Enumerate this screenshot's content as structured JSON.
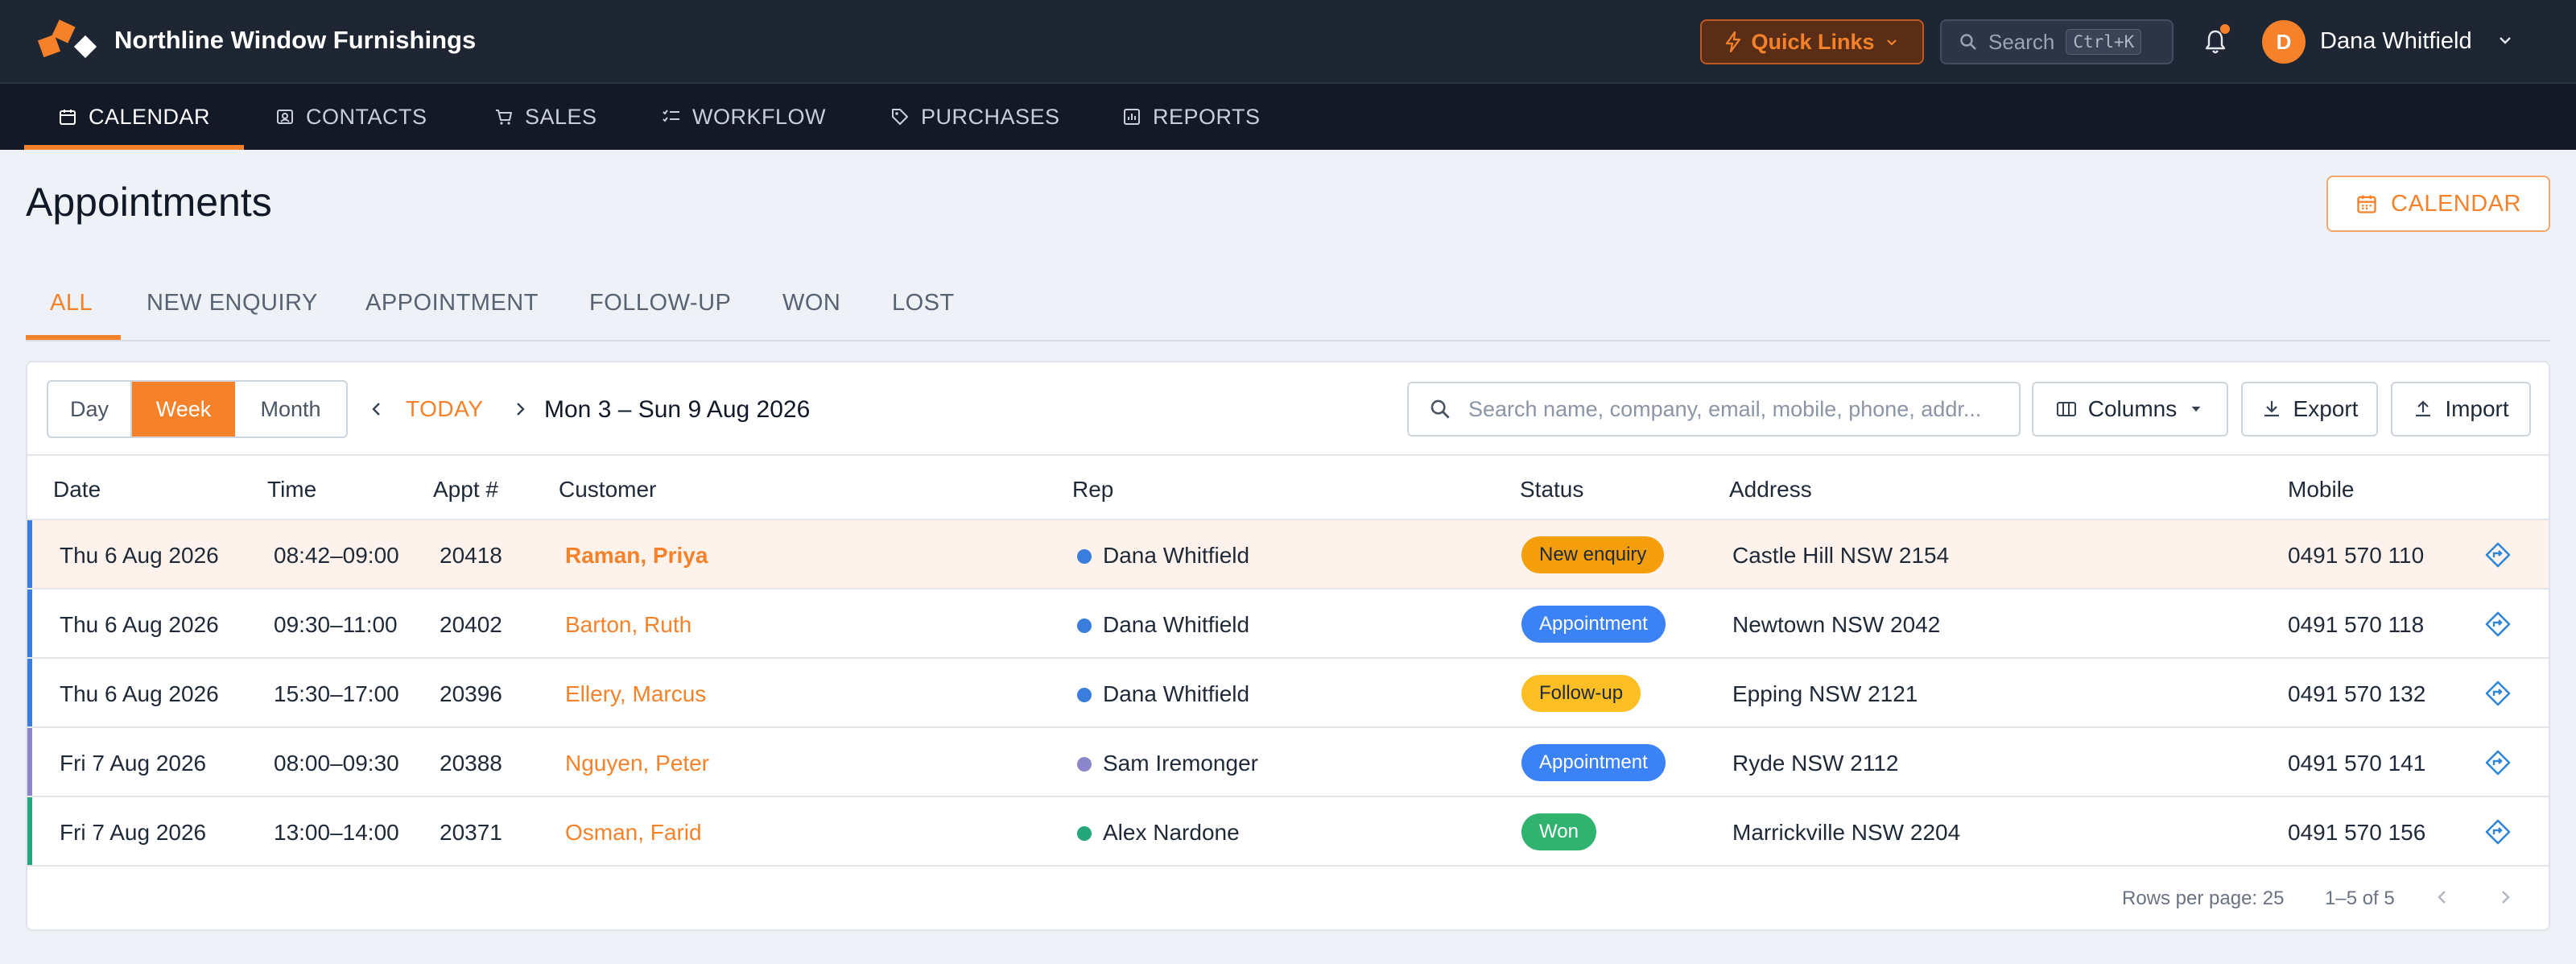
{
  "app": {
    "brand": "Northline Window Furnishings",
    "quick_links": "Quick Links",
    "search_label": "Search",
    "search_shortcut": "Ctrl+K",
    "user_initial": "D",
    "user_name": "Dana Whitfield",
    "accent_color": "#f5822a"
  },
  "nav": [
    {
      "label": "CALENDAR",
      "icon": "calendar-icon",
      "active": true
    },
    {
      "label": "CONTACTS",
      "icon": "contact-card-icon",
      "active": false
    },
    {
      "label": "SALES",
      "icon": "cart-icon",
      "active": false
    },
    {
      "label": "WORKFLOW",
      "icon": "checklist-icon",
      "active": false
    },
    {
      "label": "PURCHASES",
      "icon": "tag-icon",
      "active": false
    },
    {
      "label": "REPORTS",
      "icon": "report-icon",
      "active": false
    }
  ],
  "page": {
    "title": "Appointments",
    "calendar_button": "CALENDAR"
  },
  "tabs": [
    {
      "label": "ALL",
      "active": true
    },
    {
      "label": "NEW ENQUIRY",
      "active": false
    },
    {
      "label": "APPOINTMENT",
      "active": false
    },
    {
      "label": "FOLLOW-UP",
      "active": false
    },
    {
      "label": "WON",
      "active": false
    },
    {
      "label": "LOST",
      "active": false
    }
  ],
  "toolbar": {
    "view_day": "Day",
    "view_week": "Week",
    "view_month": "Month",
    "selected_view": "Week",
    "today": "TODAY",
    "range": "Mon 3 – Sun 9 Aug 2026",
    "search_placeholder": "Search name, company, email, mobile, phone, addr...",
    "columns": "Columns",
    "export": "Export",
    "import": "Import"
  },
  "table": {
    "headers": [
      "Date",
      "Time",
      "Appt #",
      "Customer",
      "Rep",
      "Status",
      "Address",
      "Mobile"
    ],
    "rows": [
      {
        "date": "Thu 6 Aug 2026",
        "time": "08:42–09:00",
        "appt": "20418",
        "customer": "Raman, Priya",
        "rep": "Dana Whitfield",
        "rep_color": "#3b7ddd",
        "status": "New enquiry",
        "status_bg": "#f59e0b",
        "status_fg": "#1f2937",
        "address": "Castle Hill NSW 2154",
        "mobile": "0491 570 110",
        "highlighted": true
      },
      {
        "date": "Thu 6 Aug 2026",
        "time": "09:30–11:00",
        "appt": "20402",
        "customer": "Barton, Ruth",
        "rep": "Dana Whitfield",
        "rep_color": "#3b7ddd",
        "status": "Appointment",
        "status_bg": "#3b82f6",
        "status_fg": "#ffffff",
        "address": "Newtown NSW 2042",
        "mobile": "0491 570 118",
        "highlighted": false
      },
      {
        "date": "Thu 6 Aug 2026",
        "time": "15:30–17:00",
        "appt": "20396",
        "customer": "Ellery, Marcus",
        "rep": "Dana Whitfield",
        "rep_color": "#3b7ddd",
        "status": "Follow-up",
        "status_bg": "#fbbf24",
        "status_fg": "#1f2937",
        "address": "Epping NSW 2121",
        "mobile": "0491 570 132",
        "highlighted": false
      },
      {
        "date": "Fri 7 Aug 2026",
        "time": "08:00–09:30",
        "appt": "20388",
        "customer": "Nguyen, Peter",
        "rep": "Sam Iremonger",
        "rep_color": "#8b86c9",
        "status": "Appointment",
        "status_bg": "#3b82f6",
        "status_fg": "#ffffff",
        "address": "Ryde NSW 2112",
        "mobile": "0491 570 141",
        "highlighted": false
      },
      {
        "date": "Fri 7 Aug 2026",
        "time": "13:00–14:00",
        "appt": "20371",
        "customer": "Osman, Farid",
        "rep": "Alex Nardone",
        "rep_color": "#22a67a",
        "status": "Won",
        "status_bg": "#2fb36f",
        "status_fg": "#ffffff",
        "address": "Marrickville NSW 2204",
        "mobile": "0491 570 156",
        "highlighted": false
      }
    ]
  },
  "footer": {
    "rows_per_page": "Rows per page: 25",
    "range": "1–5 of 5"
  }
}
